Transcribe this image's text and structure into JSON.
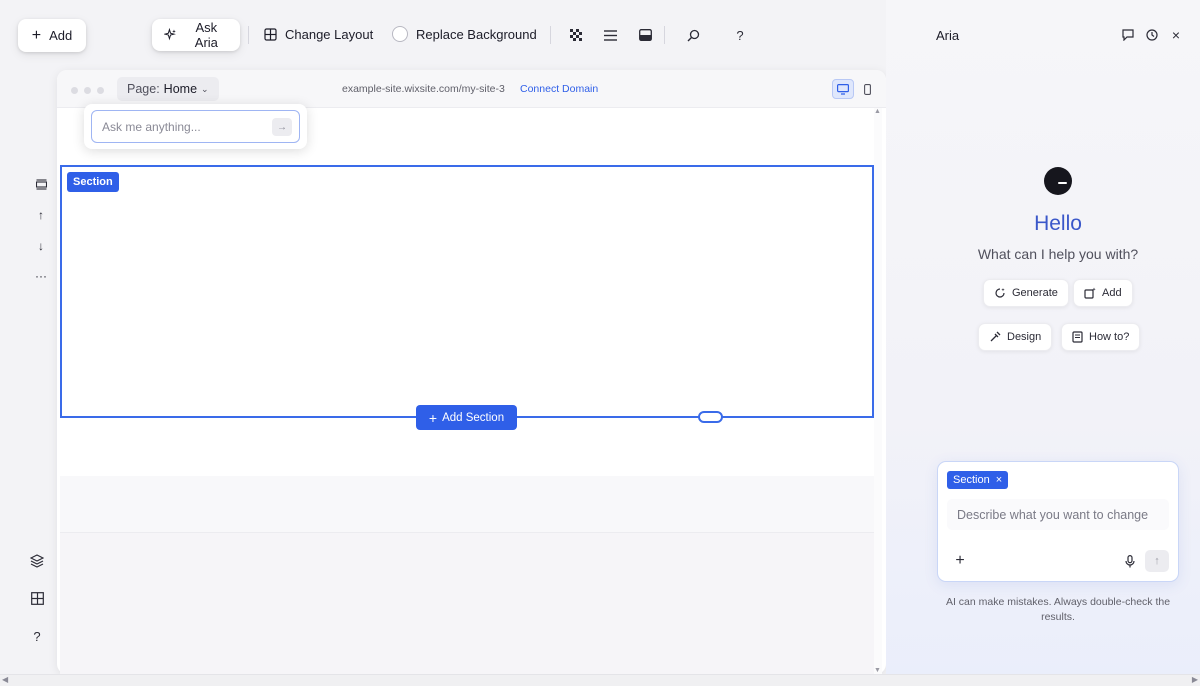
{
  "toolbar": {
    "add_label": "Add",
    "ask_aria_label": "Ask Aria",
    "change_layout_label": "Change Layout",
    "replace_background_label": "Replace Background",
    "help_label": "?"
  },
  "canvas": {
    "page_prefix": "Page:",
    "page_name": "Home",
    "url": "example-site.wixsite.com/my-site-3",
    "connect_domain": "Connect Domain",
    "section_tag": "Section",
    "add_section_label": "Add Section",
    "ask_placeholder": "Ask me anything..."
  },
  "rail": {
    "help_label": "?"
  },
  "aria": {
    "title": "Aria",
    "hello": "Hello",
    "subtitle": "What can I help you with?",
    "chips": [
      "Generate",
      "Add",
      "Design",
      "How to?"
    ],
    "context_chip": "Section",
    "describe_placeholder": "Describe what you want to change",
    "disclaimer": "AI can make mistakes. Always double-check the results."
  },
  "colors": {
    "accent": "#2f5fe8",
    "hello_text": "#3a57c9"
  }
}
